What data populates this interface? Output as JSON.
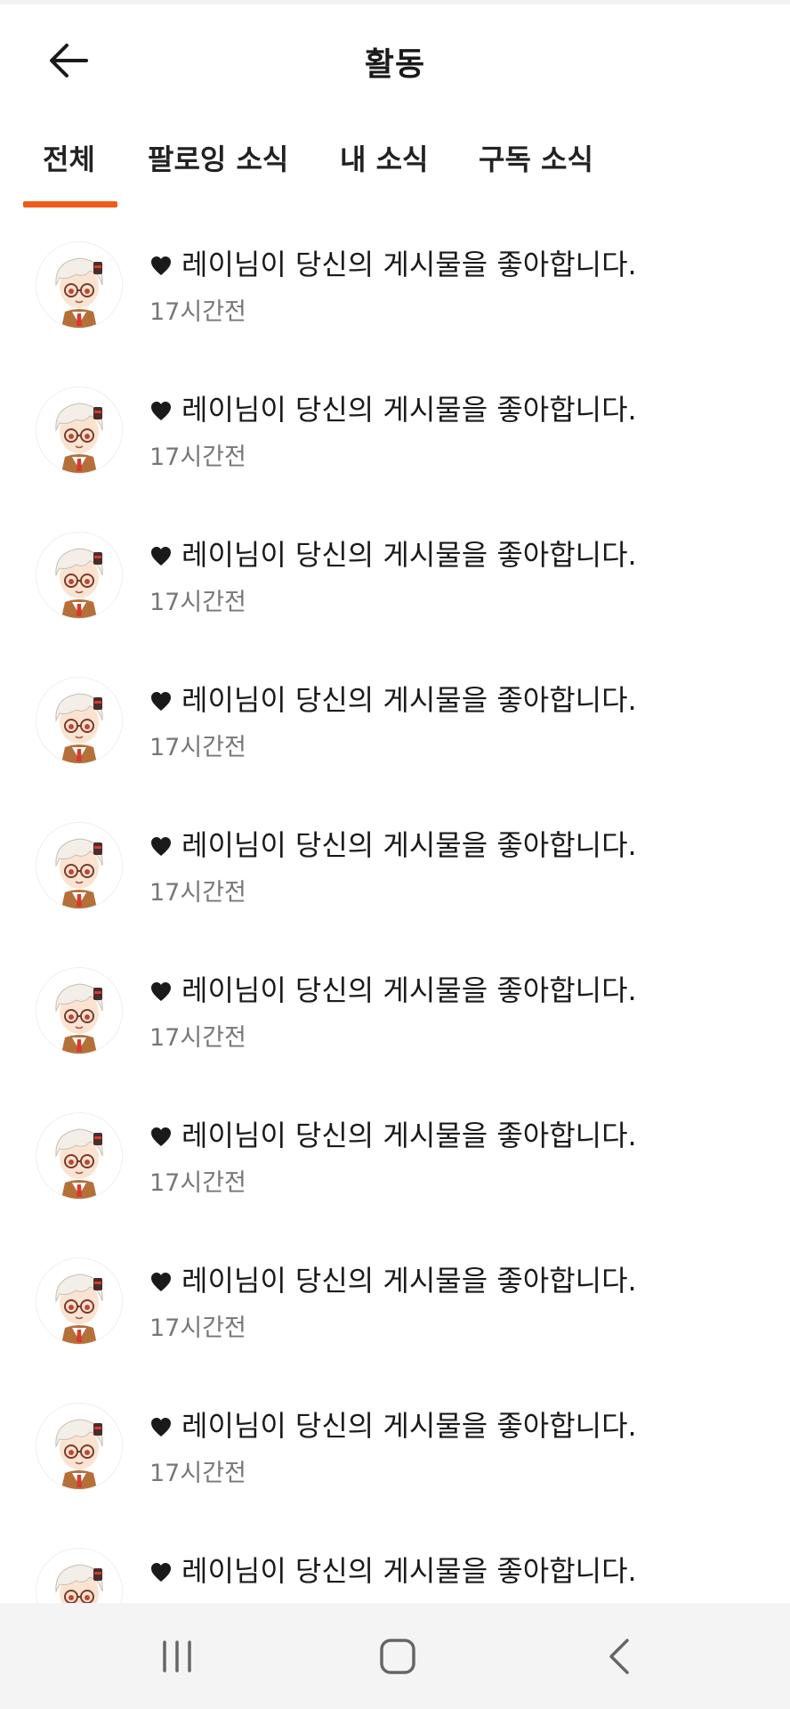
{
  "header": {
    "title": "활동",
    "back_icon": "arrow-left-icon"
  },
  "tabs": [
    {
      "label": "전체",
      "active": true
    },
    {
      "label": "팔로잉 소식",
      "active": false
    },
    {
      "label": "내 소식",
      "active": false
    },
    {
      "label": "구독 소식",
      "active": false
    }
  ],
  "accent_color": "#f05a1a",
  "notifications": [
    {
      "message": "레이님이 당신의 게시물을 좋아합니다.",
      "time": "17시간전",
      "icon": "heart-icon"
    },
    {
      "message": "레이님이 당신의 게시물을 좋아합니다.",
      "time": "17시간전",
      "icon": "heart-icon"
    },
    {
      "message": "레이님이 당신의 게시물을 좋아합니다.",
      "time": "17시간전",
      "icon": "heart-icon"
    },
    {
      "message": "레이님이 당신의 게시물을 좋아합니다.",
      "time": "17시간전",
      "icon": "heart-icon"
    },
    {
      "message": "레이님이 당신의 게시물을 좋아합니다.",
      "time": "17시간전",
      "icon": "heart-icon"
    },
    {
      "message": "레이님이 당신의 게시물을 좋아합니다.",
      "time": "17시간전",
      "icon": "heart-icon"
    },
    {
      "message": "레이님이 당신의 게시물을 좋아합니다.",
      "time": "17시간전",
      "icon": "heart-icon"
    },
    {
      "message": "레이님이 당신의 게시물을 좋아합니다.",
      "time": "17시간전",
      "icon": "heart-icon"
    },
    {
      "message": "레이님이 당신의 게시물을 좋아합니다.",
      "time": "17시간전",
      "icon": "heart-icon"
    },
    {
      "message": "레이님이 당신의 게시물을 좋아합니다.",
      "time": "",
      "icon": "heart-icon"
    }
  ],
  "system_nav": {
    "recent_icon": "recent-apps-icon",
    "home_icon": "home-icon",
    "back_icon": "system-back-icon"
  }
}
